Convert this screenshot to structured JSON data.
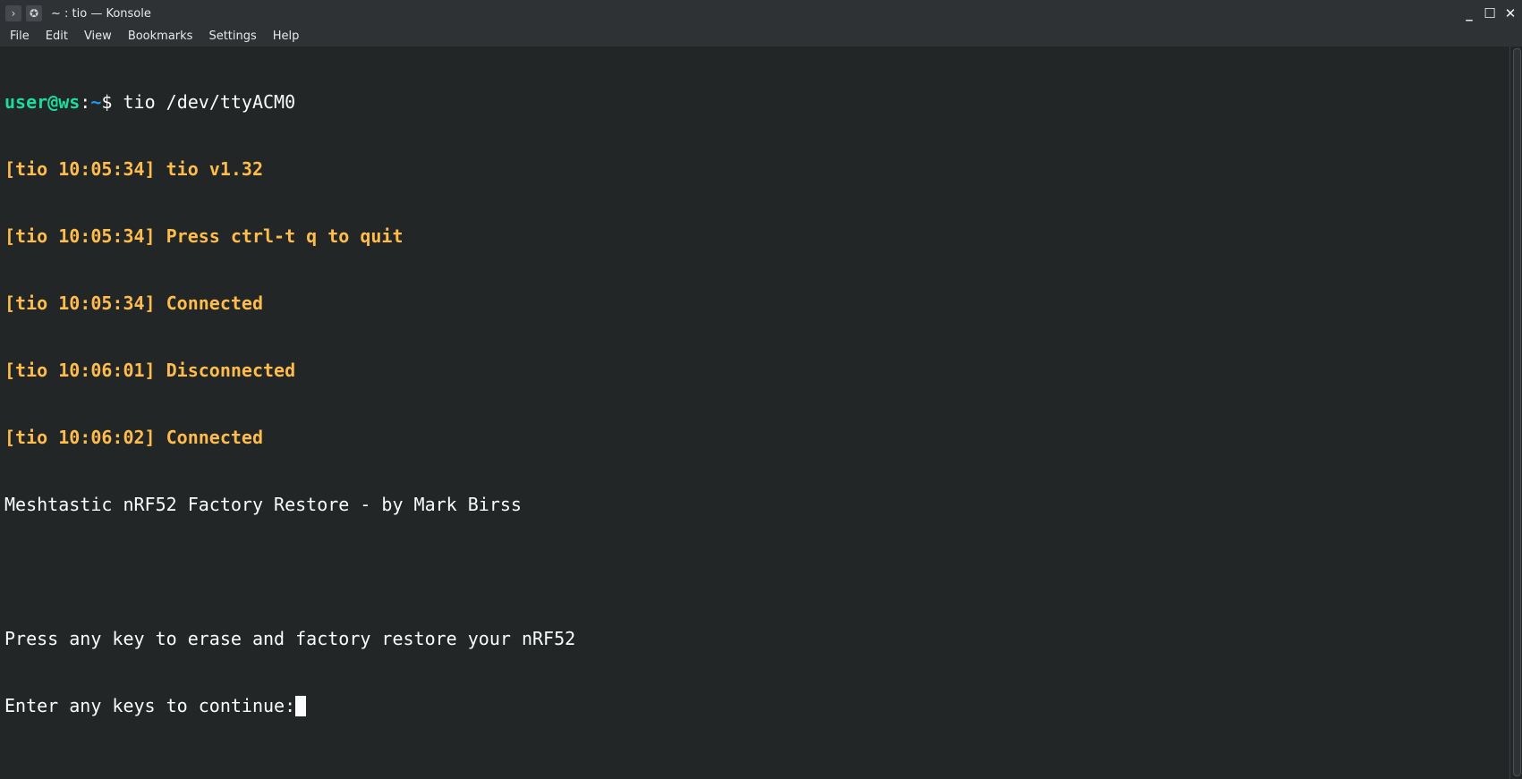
{
  "window": {
    "title": "~ : tio — Konsole",
    "title_icons": {
      "terminal": "terminal-icon",
      "pin": "pin-icon"
    },
    "controls": {
      "minimize": "minimize-icon",
      "maximize": "maximize-icon",
      "close": "close-icon"
    }
  },
  "menubar": {
    "items": [
      "File",
      "Edit",
      "View",
      "Bookmarks",
      "Settings",
      "Help"
    ]
  },
  "terminal": {
    "prompt_user": "user@ws",
    "prompt_sep": ":",
    "prompt_path": "~",
    "prompt_symbol": "$ ",
    "command": "tio /dev/ttyACM0",
    "tio_lines": [
      "[tio 10:05:34] tio v1.32",
      "[tio 10:05:34] Press ctrl-t q to quit",
      "[tio 10:05:34] Connected",
      "[tio 10:06:01] Disconnected",
      "[tio 10:06:02] Connected"
    ],
    "output_lines": [
      "Meshtastic nRF52 Factory Restore - by Mark Birss",
      "",
      "Press any key to erase and factory restore your nRF52",
      "Enter any keys to continue:"
    ]
  },
  "colors": {
    "background": "#232627",
    "tio_text": "#fdbc4b",
    "user_text": "#1cdc9a",
    "path_text": "#1d99f3",
    "default_text": "#fcfcfc"
  }
}
